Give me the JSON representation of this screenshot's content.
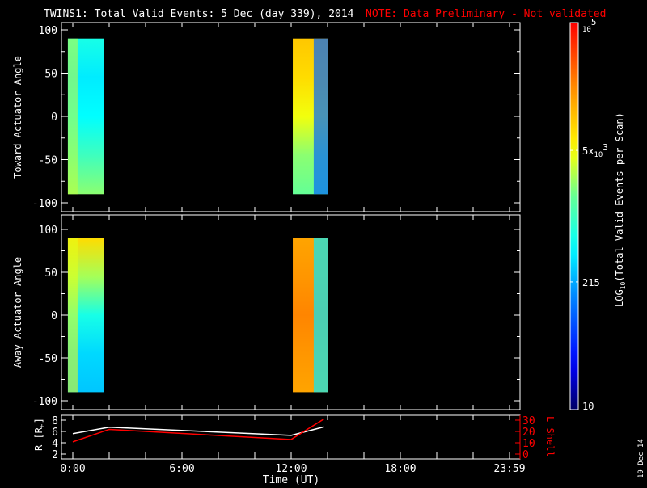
{
  "title": {
    "main": "TWINS1: Total Valid Events:  5 Dec (day 339), 2014",
    "note": "NOTE: Data Preliminary - Not validated",
    "note_color": "#ff0000"
  },
  "footer_date": "19 Dec 14",
  "chart_data": [
    {
      "type": "heatmap",
      "ylabel": "Toward Actuator Angle",
      "ylim": [
        -110,
        110
      ],
      "yticks": [
        "100",
        "50",
        "0",
        "-50",
        "-100"
      ],
      "ytick_values": [
        100,
        50,
        0,
        -50,
        -100
      ],
      "angle_range": [
        -90,
        90
      ],
      "scans": [
        {
          "t_start_h": -0.27,
          "t_end_h": 1.69,
          "levels_top_to_bottom": [
            0.45,
            0.4,
            0.42,
            0.5,
            0.58
          ],
          "level_left": 0.62
        },
        {
          "t_start_h": 12.09,
          "t_end_h": 14.04,
          "levels_top_to_bottom": [
            0.75,
            0.72,
            0.66,
            0.58,
            0.55
          ],
          "level_right": 0.25
        }
      ]
    },
    {
      "type": "heatmap",
      "ylabel": "Away Actuator Angle",
      "ylim": [
        -110,
        110
      ],
      "yticks": [
        "100",
        "50",
        "0",
        "-50",
        "-100"
      ],
      "ytick_values": [
        100,
        50,
        0,
        -50,
        -100
      ],
      "angle_range": [
        -90,
        90
      ],
      "scans": [
        {
          "t_start_h": -0.27,
          "t_end_h": 1.69,
          "levels_top_to_bottom": [
            0.72,
            0.6,
            0.45,
            0.38,
            0.36
          ],
          "level_left": 0.65
        },
        {
          "t_start_h": 12.09,
          "t_end_h": 14.04,
          "levels_top_to_bottom": [
            0.8,
            0.82,
            0.84,
            0.82,
            0.8
          ],
          "level_right": 0.4
        }
      ]
    },
    {
      "type": "line",
      "xlabel": "Time (UT)",
      "xticks": [
        "0:00",
        "6:00",
        "12:00",
        "18:00",
        "23:59"
      ],
      "xtick_values": [
        0,
        6,
        12,
        18,
        24
      ],
      "xlim": [
        0,
        24
      ],
      "ylabel": "R [R",
      "ylabel_sub": "E",
      "ylabel_end": "]",
      "ylim": [
        2,
        8
      ],
      "yticks": [
        "8",
        "6",
        "4",
        "2"
      ],
      "y2label": "L Shell",
      "y2lim": [
        0,
        30
      ],
      "y2ticks": [
        "30",
        "20",
        "10",
        "0"
      ],
      "series": [
        {
          "name": "R",
          "color": "#ffffff",
          "axis": "left",
          "x": [
            0,
            2,
            12,
            13.8
          ],
          "y": [
            5.6,
            6.75,
            5.3,
            6.8
          ]
        },
        {
          "name": "L Shell",
          "color": "#ff0000",
          "axis": "right",
          "x": [
            0,
            2,
            12,
            13.8
          ],
          "y": [
            10.8,
            21.8,
            12.9,
            31
          ]
        }
      ]
    }
  ],
  "colorbar": {
    "label_pre": "LOG",
    "label_sub": "10",
    "label_post": "(Total Valid Events per Scan)",
    "ticks": [
      {
        "base": "10",
        "exp": "5",
        "prefix": "",
        "level": 1.0
      },
      {
        "base": "10",
        "exp": "3",
        "prefix": "5x",
        "level": 0.67
      },
      {
        "base": "215",
        "exp": "",
        "prefix": "",
        "level": 0.33
      },
      {
        "base": "10",
        "exp": "",
        "prefix": "",
        "level": 0.0
      }
    ]
  }
}
